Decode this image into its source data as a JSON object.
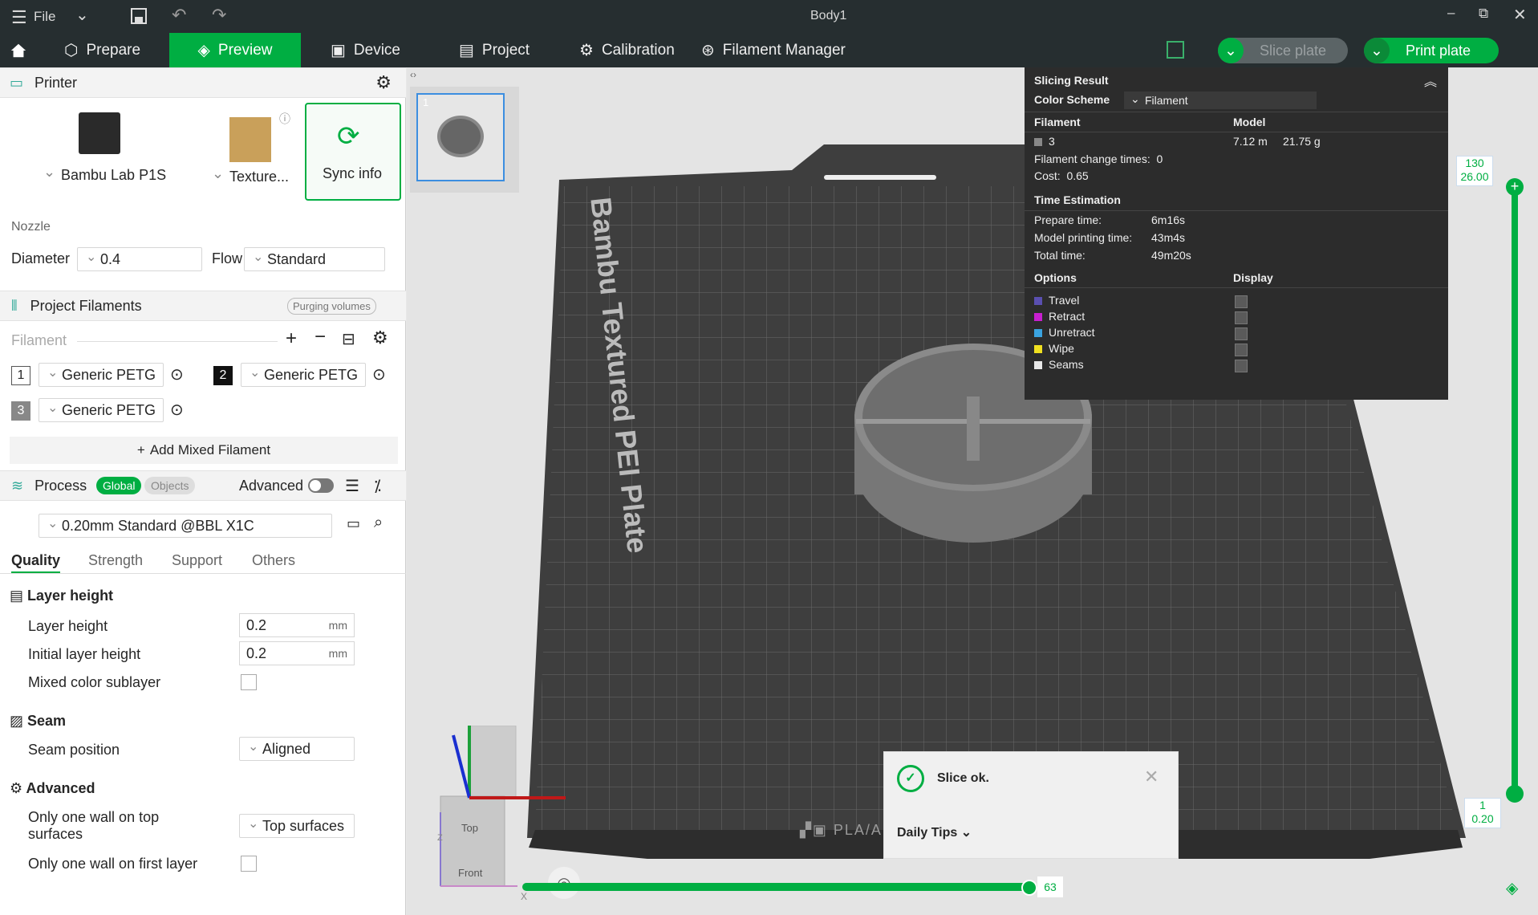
{
  "titlebar": {
    "menu": "File",
    "title": "Body1"
  },
  "menu": {
    "prepare": "Prepare",
    "preview": "Preview",
    "device": "Device",
    "project": "Project",
    "calibration": "Calibration",
    "filament_manager": "Filament Manager",
    "slice_plate": "Slice plate",
    "print_plate": "Print plate"
  },
  "printer": {
    "header": "Printer",
    "model": "Bambu Lab P1S",
    "plate": "Texture...",
    "sync": "Sync info",
    "nozzle_label": "Nozzle",
    "diameter_label": "Diameter",
    "diameter": "0.4",
    "flow_label": "Flow",
    "flow": "Standard"
  },
  "filaments": {
    "header": "Project Filaments",
    "purge": "Purging volumes",
    "label": "Filament",
    "items": [
      {
        "num": "1",
        "name": "Generic PETG"
      },
      {
        "num": "2",
        "name": "Generic PETG"
      },
      {
        "num": "3",
        "name": "Generic PETG"
      }
    ],
    "add_mixed": "Add Mixed Filament"
  },
  "process": {
    "header": "Process",
    "global": "Global",
    "objects": "Objects",
    "advanced": "Advanced",
    "preset": "0.20mm Standard @BBL X1C",
    "tabs": [
      "Quality",
      "Strength",
      "Support",
      "Others"
    ]
  },
  "quality": {
    "layer_group": "Layer height",
    "layer_height_label": "Layer height",
    "layer_height": "0.2",
    "initial_label": "Initial layer height",
    "initial": "0.2",
    "unit": "mm",
    "mixed_label": "Mixed color sublayer",
    "seam_group": "Seam",
    "seam_pos_label": "Seam position",
    "seam_pos": "Aligned",
    "adv_group": "Advanced",
    "one_wall_top_label": "Only one wall on top surfaces",
    "one_wall_top": "Top surfaces",
    "one_wall_first_label": "Only one wall on first layer"
  },
  "plate": {
    "thumb_num": "1",
    "bed_label": "Bambu Textured PEI Plate",
    "bed_footer": "PLA/ABS/PETG"
  },
  "result": {
    "title": "Slicing Result",
    "color_scheme_label": "Color Scheme",
    "color_scheme": "Filament",
    "filament_col": "Filament",
    "model_col": "Model",
    "filament_num": "3",
    "length": "7.12 m",
    "weight": "21.75 g",
    "change_times": "Filament change times:  0",
    "cost": "Cost:  0.65",
    "time_header": "Time Estimation",
    "prepare_label": "Prepare time:",
    "prepare": "6m16s",
    "model_label": "Model printing time:",
    "model": "43m4s",
    "total_label": "Total time:",
    "total": "49m20s",
    "options_col": "Options",
    "display_col": "Display",
    "options": [
      {
        "name": "Travel",
        "color": "#5a4fb0"
      },
      {
        "name": "Retract",
        "color": "#c81fd0"
      },
      {
        "name": "Unretract",
        "color": "#3aa3e0"
      },
      {
        "name": "Wipe",
        "color": "#f0e020"
      },
      {
        "name": "Seams",
        "color": "#e8e8e8"
      }
    ]
  },
  "layers": {
    "top_layer": "130",
    "top_height": "26.00",
    "bottom_layer": "1",
    "bottom_height": "0.20",
    "bottom_progress": 0.996,
    "move_value": "63",
    "move_fraction": 0.985
  },
  "notice": {
    "text": "Slice ok.",
    "tips": "Daily Tips"
  },
  "gizmo": {
    "top": "Top",
    "front": "Front",
    "x": "X",
    "z": "Z"
  },
  "colors": {
    "accent": "#00ae42",
    "dark": "#262e30"
  }
}
